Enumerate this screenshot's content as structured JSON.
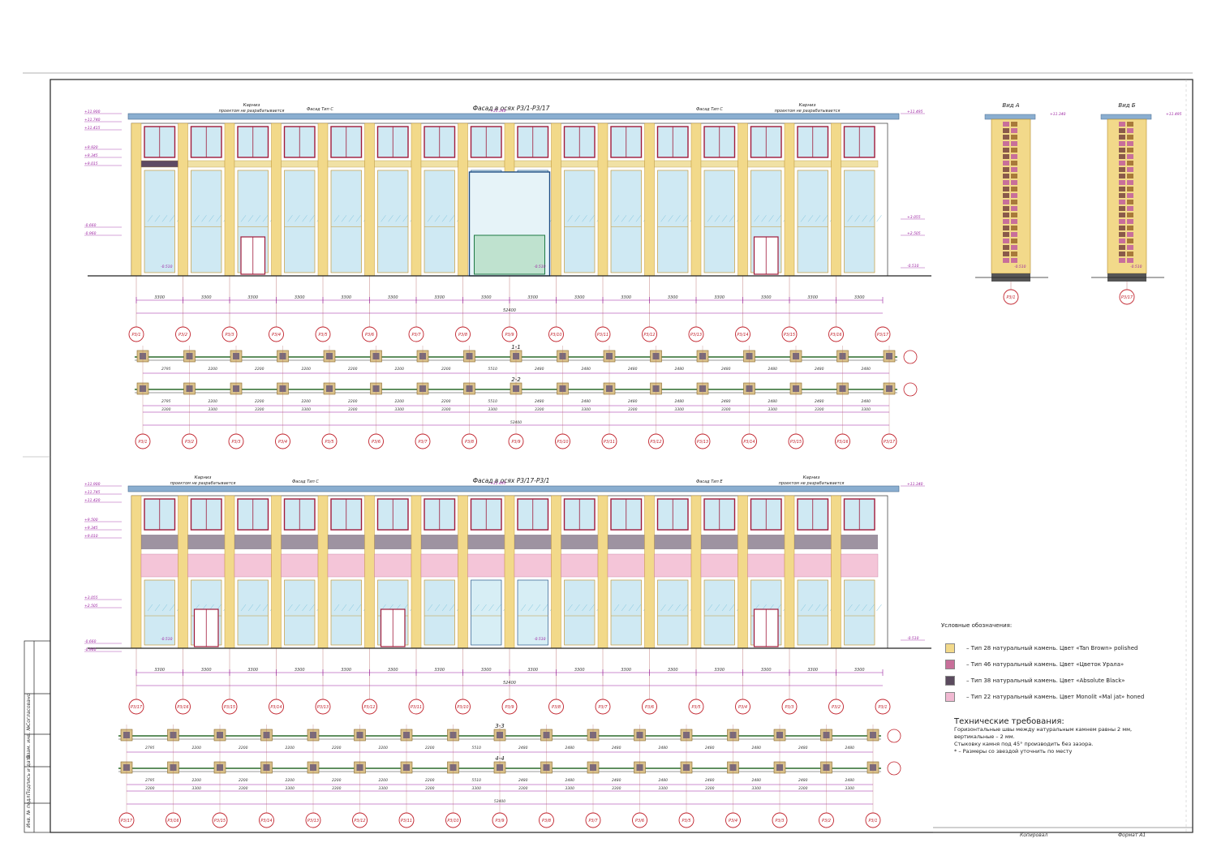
{
  "facade_top": {
    "title": "Фасад в осях Р3/1-Р3/17",
    "cornice_label": "Карниз",
    "cornice_note": "проектом не разрабатывается",
    "type_c": "Фасад Тип С",
    "total_dim": "52400",
    "section_1": "1-1",
    "section_2": "2-2",
    "axes": [
      "Р3/1",
      "Р3/2",
      "Р3/3",
      "Р3/4",
      "Р3/5",
      "Р3/6",
      "Р3/7",
      "Р3/8",
      "Р3/9",
      "Р3/10",
      "Р3/11",
      "Р3/12",
      "Р3/13",
      "Р3/14",
      "Р3/15",
      "Р3/16",
      "Р3/17"
    ],
    "elev_left": [
      "+11.900",
      "+11.740",
      "+11.415",
      "+9.920",
      "+9.345",
      "+9.015",
      "-0.660",
      "-0.960"
    ],
    "elev_right": [
      "+11.495",
      "+3.055",
      "+2.505",
      "-0.510"
    ],
    "elev_mid": [
      "+11.340",
      "-0.510",
      "-0.510"
    ]
  },
  "facade_bottom": {
    "title": "Фасад в осях Р3/17-Р3/1",
    "cornice_label": "Карниз",
    "cornice_note": "проектом не разрабатывается",
    "type_c": "Фасад Тип С",
    "type_e": "Фасад Тип Е",
    "total_dim": "52400",
    "section_3": "3-3",
    "section_4": "4-4",
    "axes": [
      "Р3/17",
      "Р3/16",
      "Р3/15",
      "Р3/14",
      "Р3/13",
      "Р3/12",
      "Р3/11",
      "Р3/10",
      "Р3/9",
      "Р3/8",
      "Р3/7",
      "Р3/6",
      "Р3/5",
      "Р3/4",
      "Р3/3",
      "Р3/2",
      "Р3/1"
    ],
    "elev_left": [
      "+11.900",
      "+11.745",
      "+11.420",
      "+9.500",
      "+9.345",
      "+9.010",
      "+3.055",
      "+2.505",
      "-0.660",
      "-0.960"
    ],
    "elev_right": [
      "+11.340",
      "-0.510"
    ],
    "elev_mid": [
      "+11.495",
      "-0.510",
      "-0.510"
    ]
  },
  "views": {
    "view_a": "Вид А",
    "view_b": "Вид Б",
    "view_a_axis": "Р3/1",
    "view_b_axis": "Р3/17",
    "view_a_top": "+11.340",
    "view_b_top": "+11.495",
    "view_a_bot": "-0.510",
    "view_b_bot": "-0.510"
  },
  "plan_dims": {
    "bay": "3300",
    "mid": "5510",
    "values_a": [
      "2795",
      "2200",
      "2200",
      "2200",
      "2200",
      "2200",
      "2200",
      "2480",
      "2480",
      "2480",
      "2480",
      "2480",
      "2480",
      "2480",
      "2480"
    ]
  },
  "legend": {
    "title": "Условные обозначения:",
    "items": [
      {
        "text": "– Тип 28 натуральный камень. Цвет «Tan Brown» polished",
        "color": "#f2d98a"
      },
      {
        "text": "– Тип 46 натуральный камень. Цвет «Цветок Урала»",
        "color": "#c86f9a"
      },
      {
        "text": "– Тип 38 натуральный камень. Цвет «Absolute Black»",
        "color": "#5b4b5e"
      },
      {
        "text": "– Тип 22 натуральный камень. Цвет Monolit «Mal jat» honed",
        "color": "#f1b9d2"
      }
    ]
  },
  "tech": {
    "title": "Технические требования:",
    "lines": [
      "Горизонтальные швы между натуральным камнем равны 2 мм,",
      "вертикальные – 2 мм.",
      "Стыковку камня под 45° производить без зазора.",
      "* – Размеры со звездой уточнить по месту"
    ]
  },
  "stamp": {
    "copied": "Копировал",
    "format": "Формат А1",
    "side": [
      "Инв. № подл.",
      "Подпись и дата",
      "Взам. инв. №",
      "Согласовано"
    ]
  },
  "colors": {
    "axis": "#c0202a",
    "dim": "#9a1fa0",
    "stone": "#f2d98a",
    "frame": "#a01a3a",
    "glass": "#cfe9f3",
    "cornice": "#8aaed0",
    "spandrel": "#5e4b63"
  }
}
